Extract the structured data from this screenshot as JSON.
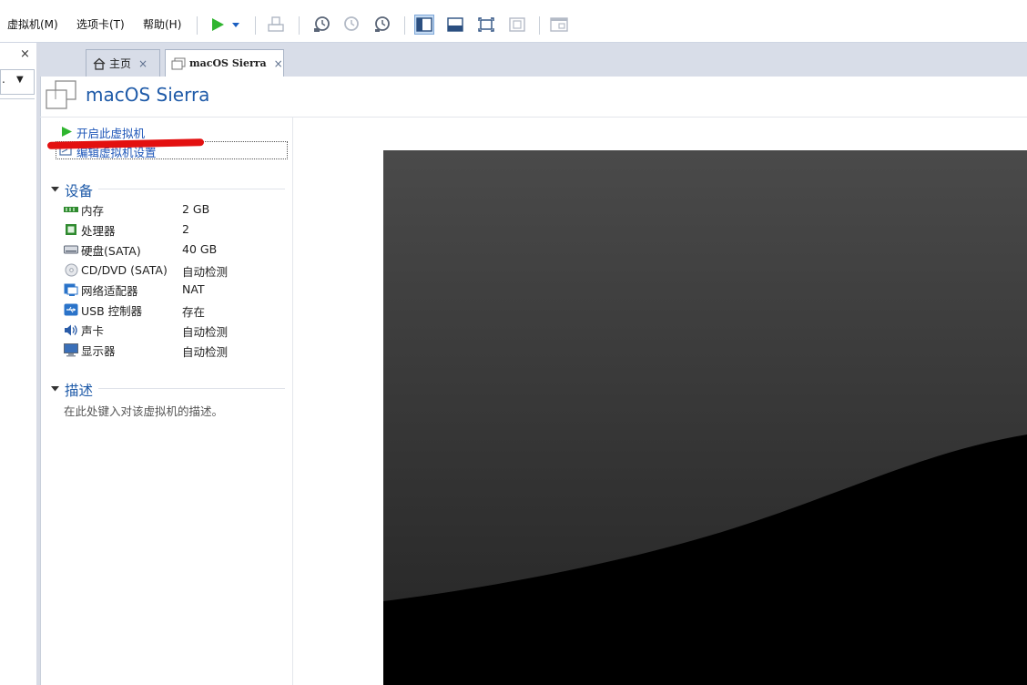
{
  "menu": {
    "vm_label": "虚拟机(M)",
    "tabs_label": "选项卡(T)",
    "help_label": "帮助(H)"
  },
  "library": {
    "close_glyph": "×",
    "dropdown_text": ".",
    "dropdown_arrow": "▼"
  },
  "tabs": [
    {
      "label": "主页",
      "close": "×"
    },
    {
      "label": "macOS Sierra",
      "close": "×"
    }
  ],
  "vm": {
    "title": "macOS Sierra",
    "power_on": "开启此虚拟机",
    "edit_settings": "编辑虚拟机设置"
  },
  "devices": {
    "header": "设备",
    "items": [
      {
        "name": "内存",
        "value": "2 GB",
        "icon": "memory-icon"
      },
      {
        "name": "处理器",
        "value": "2",
        "icon": "processor-icon"
      },
      {
        "name": "硬盘(SATA)",
        "value": "40 GB",
        "icon": "hard-disk-icon"
      },
      {
        "name": "CD/DVD (SATA)",
        "value": "自动检测",
        "icon": "cd-dvd-icon"
      },
      {
        "name": "网络适配器",
        "value": "NAT",
        "icon": "network-adapter-icon"
      },
      {
        "name": "USB 控制器",
        "value": "存在",
        "icon": "usb-controller-icon"
      },
      {
        "name": "声卡",
        "value": "自动检测",
        "icon": "sound-card-icon"
      },
      {
        "name": "显示器",
        "value": "自动检测",
        "icon": "display-icon"
      }
    ]
  },
  "description": {
    "header": "描述",
    "placeholder": "在此处键入对该虚拟机的描述。"
  },
  "colors": {
    "accent": "#1e5aa8",
    "play_green": "#2fb52f",
    "annotation_red": "#e31010"
  }
}
